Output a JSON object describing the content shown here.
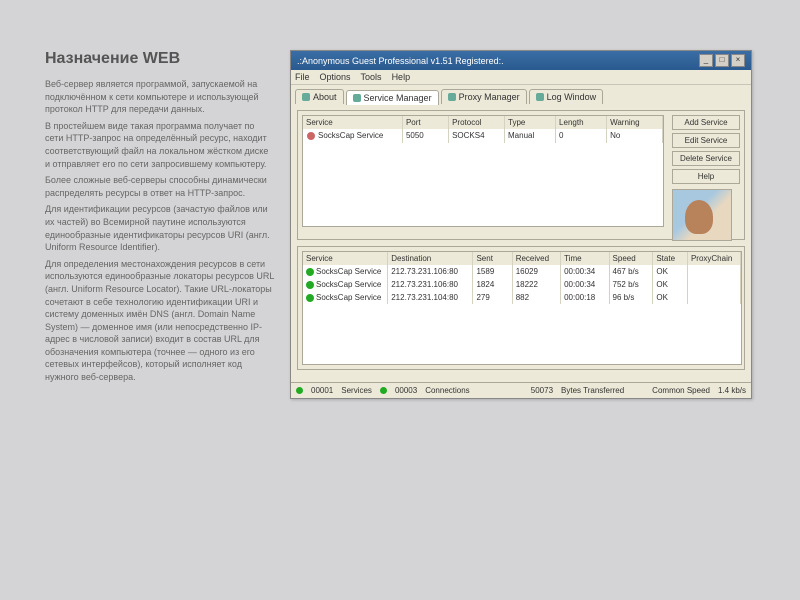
{
  "article": {
    "title": "Назначение WEB",
    "p1": "Веб-сервер является программой, запускаемой на подключённом к сети компьютере и использующей протокол HTTP для передачи данных.",
    "p2": "В простейшем виде такая программа получает по сети HTTP-запрос на определённый ресурс, находит соответствующий файл на локальном жёстком диске и отправляет его по сети запросившему компьютеру.",
    "p3": "Более сложные веб-серверы способны динамически распределять ресурсы в ответ на HTTP-запрос.",
    "p4": "Для идентификации ресурсов (зачастую файлов или их частей) во Всемирной паутине используются единообразные идентификаторы ресурсов URI (англ. Uniform Resource Identifier).",
    "p5": "Для определения местонахождения ресурсов в сети используются единообразные локаторы ресурсов URL (англ. Uniform Resource Locator). Такие URL-локаторы сочетают в себе технологию идентификации URI и систему доменных имён DNS (англ. Domain Name System) — доменное имя (или непосредственно IP-адрес в числовой записи) входит в состав URL для обозначения компьютера (точнее — одного из его сетевых интерфейсов), который исполняет код нужного веб-сервера."
  },
  "window": {
    "title": ".:Anonymous Guest Professional v1.51 Registered:.",
    "menu": [
      "File",
      "Options",
      "Tools",
      "Help"
    ],
    "tabs": [
      "About",
      "Service Manager",
      "Proxy Manager",
      "Log Window"
    ],
    "active_tab": 1
  },
  "svc_table": {
    "headers": [
      "Service",
      "Port",
      "Protocol",
      "Type",
      "Length",
      "Warning"
    ],
    "rows": [
      {
        "icon": "socks",
        "service": "SocksCap Service",
        "port": "5050",
        "protocol": "SOCKS4",
        "type": "Manual",
        "length": "0",
        "warning": "No"
      }
    ]
  },
  "buttons": {
    "add": "Add Service",
    "edit": "Edit Service",
    "del": "Delete Service",
    "help": "Help"
  },
  "conn_table": {
    "headers": [
      "Service",
      "Destination",
      "Sent",
      "Received",
      "Time",
      "Speed",
      "State",
      "ProxyChain"
    ],
    "rows": [
      {
        "service": "SocksCap Service",
        "dest": "212.73.231.106:80",
        "sent": "1589",
        "recv": "16029",
        "time": "00:00:34",
        "speed": "467 b/s",
        "state": "OK"
      },
      {
        "service": "SocksCap Service",
        "dest": "212.73.231.106:80",
        "sent": "1824",
        "recv": "18222",
        "time": "00:00:34",
        "speed": "752 b/s",
        "state": "OK"
      },
      {
        "service": "SocksCap Service",
        "dest": "212.73.231.104:80",
        "sent": "279",
        "recv": "882",
        "time": "00:00:18",
        "speed": "96 b/s",
        "state": "OK"
      }
    ]
  },
  "statusbar": {
    "services_n": "00001",
    "services_l": "Services",
    "conn_n": "00003",
    "conn_l": "Connections",
    "bytes_n": "50073",
    "bytes_l": "Bytes Transferred",
    "speed_l": "Common Speed",
    "speed_v": "1.4 kb/s"
  }
}
